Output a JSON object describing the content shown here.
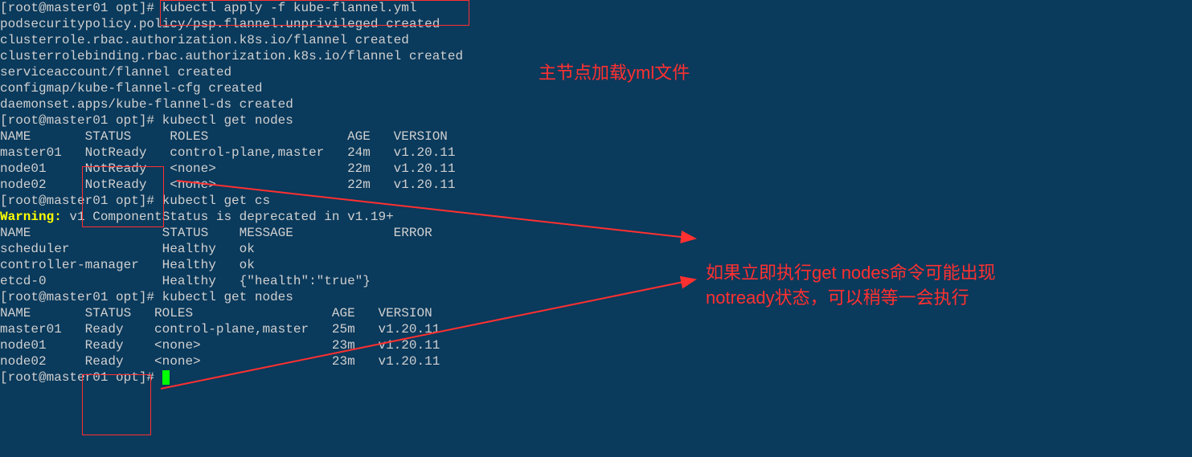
{
  "prompt": "[root@master01 opt]#",
  "cmd_apply": "kubectl apply -f kube-flannel.yml",
  "apply_output": [
    "podsecuritypolicy.policy/psp.flannel.unprivileged created",
    "clusterrole.rbac.authorization.k8s.io/flannel created",
    "clusterrolebinding.rbac.authorization.k8s.io/flannel created",
    "serviceaccount/flannel created",
    "configmap/kube-flannel-cfg created",
    "daemonset.apps/kube-flannel-ds created"
  ],
  "cmd_get_nodes": "kubectl get nodes",
  "nodes_header": "NAME       STATUS     ROLES                  AGE   VERSION",
  "nodes_before": [
    "master01   NotReady   control-plane,master   24m   v1.20.11",
    "node01     NotReady   <none>                 22m   v1.20.11",
    "node02     NotReady   <none>                 22m   v1.20.11"
  ],
  "cmd_get_cs": "kubectl get cs",
  "warning_prefix": "Warning:",
  "warning_rest": " v1 ComponentStatus is deprecated in v1.19+",
  "cs_header": "NAME                 STATUS    MESSAGE             ERROR",
  "cs_rows": [
    "scheduler            Healthy   ok",
    "controller-manager   Healthy   ok",
    "etcd-0               Healthy   {\"health\":\"true\"}"
  ],
  "nodes_header2": "NAME       STATUS   ROLES                  AGE   VERSION",
  "nodes_after": [
    "master01   Ready    control-plane,master   25m   v1.20.11",
    "node01     Ready    <none>                 23m   v1.20.11",
    "node02     Ready    <none>                 23m   v1.20.11"
  ],
  "annotations": {
    "top": "主节点加载yml文件",
    "mid1": "如果立即执行get nodes命令可能出现",
    "mid2": "notready状态，可以稍等一会执行"
  }
}
